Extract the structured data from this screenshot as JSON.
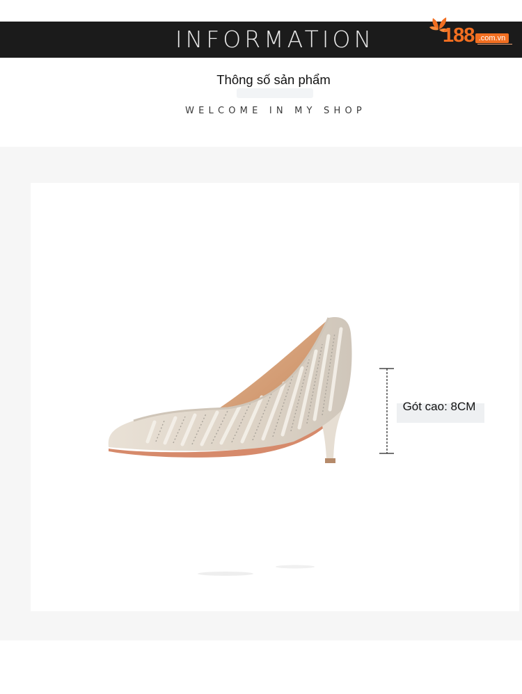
{
  "header": {
    "title": "INFORMATION",
    "logo": {
      "number": "188",
      "domain": ".com.vn",
      "icon": "leaf-icon",
      "brand_color": "#f26f21"
    },
    "background_color": "#1b1b1b"
  },
  "intro": {
    "heading": "Thông số sản phẩm",
    "subtitle": "WELCOME IN MY SHOP"
  },
  "product": {
    "image": "high-heel-pump-shoe",
    "measurement": {
      "label": "Gót cao: 8CM"
    }
  }
}
